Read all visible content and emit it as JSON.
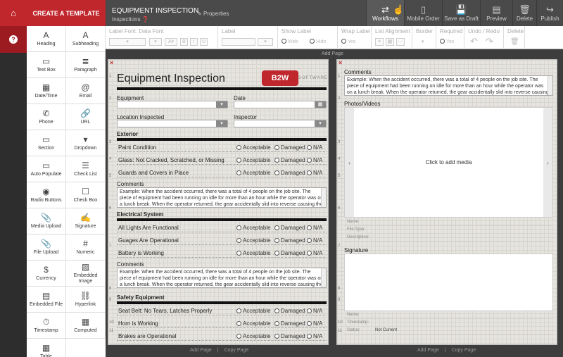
{
  "sidebar": {
    "create_label": "CREATE A TEMPLATE",
    "home_icon": "home-icon",
    "help_icon": "help-icon",
    "tools": [
      {
        "label": "Heading",
        "icon": "heading-icon"
      },
      {
        "label": "Subheading",
        "icon": "subheading-icon"
      },
      {
        "label": "Text Box",
        "icon": "textbox-icon"
      },
      {
        "label": "Paragraph",
        "icon": "paragraph-icon"
      },
      {
        "label": "Date/Time",
        "icon": "calendar-icon"
      },
      {
        "label": "Email",
        "icon": "at-icon"
      },
      {
        "label": "Phone",
        "icon": "phone-icon"
      },
      {
        "label": "URL",
        "icon": "link-icon"
      },
      {
        "label": "Section",
        "icon": "section-icon"
      },
      {
        "label": "Dropdown",
        "icon": "dropdown-icon"
      },
      {
        "label": "Auto Populate",
        "icon": "auto-populate-icon"
      },
      {
        "label": "Check List",
        "icon": "checklist-icon"
      },
      {
        "label": "Radio Buttons",
        "icon": "radio-icon"
      },
      {
        "label": "Check Box",
        "icon": "checkbox-icon"
      },
      {
        "label": "Media Upload",
        "icon": "paperclip-icon"
      },
      {
        "label": "Signature",
        "icon": "pen-icon"
      },
      {
        "label": "File Upload",
        "icon": "paperclip-icon"
      },
      {
        "label": "Numeric",
        "icon": "hash-icon"
      },
      {
        "label": "Currency",
        "icon": "dollar-icon"
      },
      {
        "label": "Embedded Image",
        "icon": "image-icon"
      },
      {
        "label": "Embedded File",
        "icon": "file-icon"
      },
      {
        "label": "Hyperlink",
        "icon": "hyperlink-icon"
      },
      {
        "label": "Timestamp",
        "icon": "stopwatch-icon"
      },
      {
        "label": "Computed",
        "icon": "calculator-icon"
      },
      {
        "label": "Table",
        "icon": "table-icon"
      }
    ]
  },
  "header": {
    "title": "EQUIPMENT INSPECTION",
    "subtitle": "Inspections",
    "properties": "Properties",
    "actions": [
      "Workflows",
      "Mobile Order",
      "Save as Draft",
      "Preview",
      "Delete",
      "Publish"
    ],
    "action_icons": [
      "workflows-icon",
      "mobile-icon",
      "save-icon",
      "preview-icon",
      "trash-icon",
      "publish-icon"
    ]
  },
  "ribbon": {
    "label_font": "Label Font: Data Font",
    "label": "Label",
    "show_label": "Show Label",
    "show_label_opt": "Web",
    "hide": "Hide",
    "wrap_label": "Wrap Label",
    "wrap_opt": "Yes",
    "list_alignment": "List Alignment",
    "border": "Border",
    "required": "Required",
    "required_opt": "Yes",
    "undo_redo": "Undo / Redo",
    "delete": "Delete",
    "bold": "B",
    "italic": "I",
    "underline": "U"
  },
  "canvas": {
    "add_page": "Add Page",
    "copy_page": "Copy Page",
    "separator": "|"
  },
  "left_page": {
    "title": "Equipment Inspection",
    "logo": "B2W",
    "logo_sub": "SOFTWARE",
    "fields": {
      "equipment": "Equipment",
      "date": "Date",
      "location": "Location Inspected",
      "inspector": "Inspector"
    },
    "options": [
      "Acceptable",
      "Damaged",
      "N/A"
    ],
    "sections": [
      {
        "name": "Exterior",
        "items": [
          "Paint Condition",
          "Glass: Not Cracked, Scratched, or Missing",
          "Guards and Covers in Place"
        ]
      },
      {
        "name": "Electrical System",
        "items": [
          "All Lights Are Functional",
          "Guages Are Operational",
          "Battery is Working"
        ]
      },
      {
        "name": "Safety Equipment",
        "items": [
          "Seat Belt: No Tears, Latches Properly",
          "Horn is Working",
          "Brakes are Operational"
        ]
      }
    ],
    "comments_label": "Comments",
    "comment_text": "Example: When the accident occurred, there was a total of 4 people on the job site. The piece of equipment had been running on idle for more than an hour while the operator was on a lunch break. When the operator returned, the gear accidentally slid into reverse causing the paver to hit the",
    "gutter": [
      "1",
      "2",
      "3",
      "4",
      "5",
      "6",
      "7",
      "8",
      "9",
      "10",
      "11"
    ]
  },
  "right_page": {
    "comments_label": "Comments",
    "comment_text": "Example: When the accident occurred, there was a total of 4 people on the job site. The piece of equipment had been running on idle for more than an hour while the operator was on a lunch break. When the operator returned, the gear accidentally slid into reverse causing the paver to hit the",
    "photos_label": "Photos/Videos",
    "media_hint": "Click to add media",
    "media_meta": [
      "Name:",
      "File Type:",
      "Description:"
    ],
    "signature_label": "Signature",
    "sig_meta": [
      "Name:",
      "Timestamp:",
      "Status:"
    ],
    "status_value": "Not Current",
    "gutter": [
      "1",
      "2",
      "3",
      "4",
      "5",
      "6",
      "7",
      "8",
      "9",
      "10",
      "11"
    ]
  }
}
